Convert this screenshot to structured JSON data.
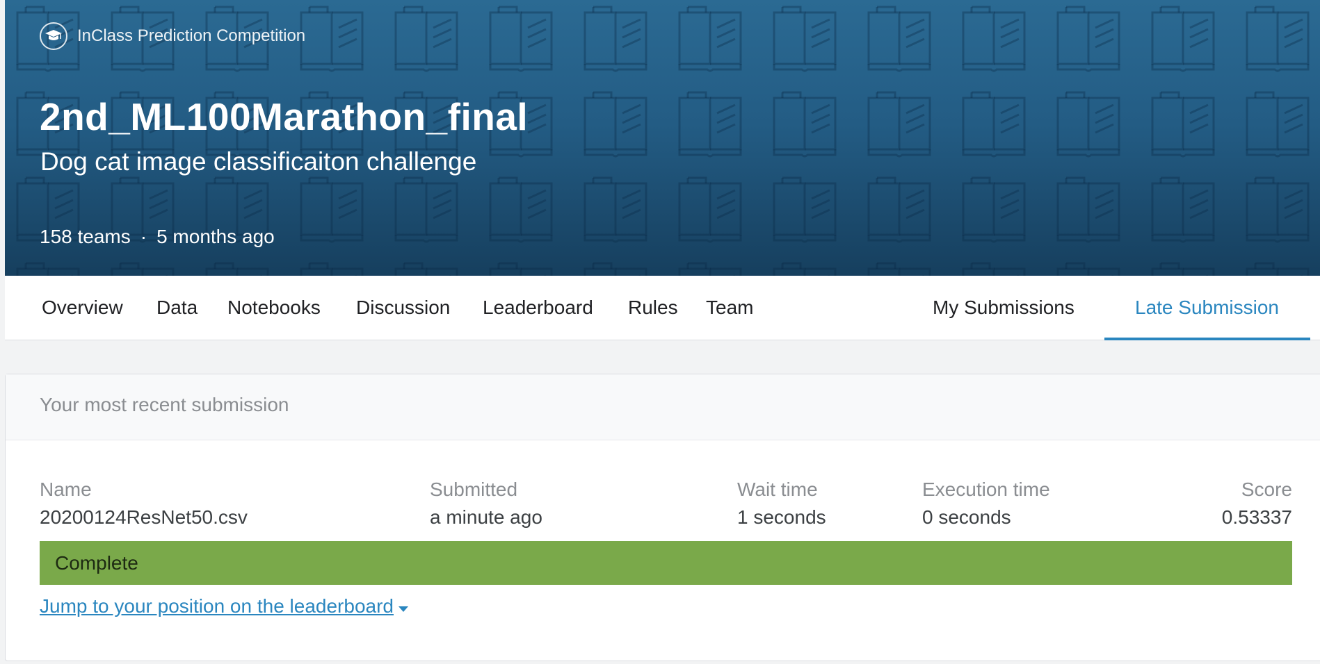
{
  "header": {
    "competition_type": "InClass Prediction Competition",
    "title": "2nd_ML100Marathon_final",
    "subtitle": "Dog cat image classificaiton challenge",
    "teams": "158 teams",
    "separator": "·",
    "age": "5 months ago"
  },
  "tabs": [
    {
      "label": "Overview"
    },
    {
      "label": "Data"
    },
    {
      "label": "Notebooks"
    },
    {
      "label": "Discussion"
    },
    {
      "label": "Leaderboard"
    },
    {
      "label": "Rules"
    },
    {
      "label": "Team"
    },
    {
      "label": "My Submissions"
    },
    {
      "label": "Late Submission",
      "active": true
    }
  ],
  "submission": {
    "heading": "Your most recent submission",
    "name_label": "Name",
    "name_value": "20200124ResNet50.csv",
    "submitted_label": "Submitted",
    "submitted_value": "a minute ago",
    "wait_label": "Wait time",
    "wait_value": "1 seconds",
    "exec_label": "Execution time",
    "exec_value": "0 seconds",
    "score_label": "Score",
    "score_value": "0.53337",
    "status": "Complete",
    "jump_link": "Jump to your position on the leaderboard"
  },
  "colors": {
    "banner": "#235c84",
    "accent": "#2a86bf",
    "status_complete": "#7aa94a"
  },
  "icons": {
    "competition_type": "graduation-cap-icon",
    "banner_pattern": "book-icon",
    "jump_link": "caret-down-icon"
  }
}
